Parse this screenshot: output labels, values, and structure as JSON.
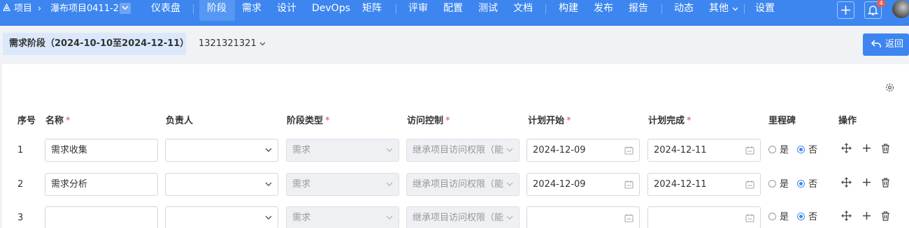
{
  "nav": {
    "project_label": "项目",
    "project_name": "瀑布项目0411-2",
    "items": [
      {
        "label": "仪表盘"
      },
      {
        "label": "阶段",
        "active": true
      },
      {
        "label": "需求"
      },
      {
        "label": "设计"
      },
      {
        "label": "DevOps"
      },
      {
        "label": "矩阵"
      },
      {
        "label": "评审"
      },
      {
        "label": "配置"
      },
      {
        "label": "测试"
      },
      {
        "label": "文档"
      },
      {
        "label": "构建"
      },
      {
        "label": "发布"
      },
      {
        "label": "报告"
      },
      {
        "label": "动态"
      },
      {
        "label": "其他"
      },
      {
        "label": "设置"
      }
    ],
    "notification_count": "4",
    "accent_color": "#3d86ef"
  },
  "header": {
    "stage_title": "需求阶段（2024-10-10至2024-12-11）",
    "version": "1321321321",
    "back_label": "返回"
  },
  "table": {
    "columns": {
      "index": "序号",
      "name": "名称",
      "owner": "负责人",
      "stage_type": "阶段类型",
      "access": "访问控制",
      "plan_start": "计划开始",
      "plan_end": "计划完成",
      "milestone": "里程碑",
      "actions": "操作"
    },
    "required_mark": "*",
    "milestone_yes": "是",
    "milestone_no": "否",
    "rows": [
      {
        "index": "1",
        "name": "需求收集",
        "owner": "",
        "stage_type": "需求",
        "access": "继承项目访问权限（能",
        "plan_start": "2024-12-09",
        "plan_end": "2024-12-11",
        "milestone": "否"
      },
      {
        "index": "2",
        "name": "需求分析",
        "owner": "",
        "stage_type": "需求",
        "access": "继承项目访问权限（能",
        "plan_start": "2024-12-09",
        "plan_end": "2024-12-11",
        "milestone": "否"
      },
      {
        "index": "3",
        "name": "",
        "owner": "",
        "stage_type": "需求",
        "access": "继承项目访问权限（能",
        "plan_start": "",
        "plan_end": "",
        "milestone": "否"
      }
    ]
  }
}
